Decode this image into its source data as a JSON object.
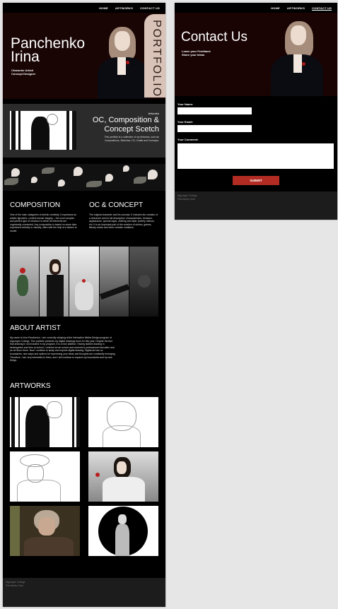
{
  "nav": {
    "home": "HOME",
    "artworks": "ARTWORKS",
    "contact": "CONTACT US"
  },
  "hero": {
    "title_line1": "Panchenko",
    "title_line2": "Irina",
    "subtitle_line1": "Character Artist/",
    "subtitle_line2": "Concept Designer",
    "band_text": "PORTFOLIO"
  },
  "oc": {
    "kicker": "Artworks",
    "title": "OC, Composition & Concept Scetch",
    "description": "This portfolio is a collection of my Artworks, such as Compositions, Sketches, OC, Drafts and Concepts."
  },
  "composition": {
    "title": "COMPOSITION",
    "text": "One of the main categories of artistic creativity. It expresses an artistic figurative, content-formal integrity – the most complex and perfect type of structure in which all elements are organically connected. Any composition is based on some idea expressed verbally or visually, often with the help of a sketch or model."
  },
  "concept": {
    "title": "OC & CONCEPT",
    "text": "The original character and his concept. It includes the creation of a character and its full description: characteristics, behavior, appearance, special signs, clothing and style, jewelry, tattoos, etc. It is an important part of the creation of stories, games, literary works and other creative creations."
  },
  "about": {
    "title": "ABOUT ARTIST",
    "text": "My name is Irina Panchenko. I am currently studying at the Interactive Media Design program of Algonquin College. This portfolio presents my digital drawings done for this year. Despite the fact that drawing is not included in my program, it is a nice addition. Having started drawing in kindergarten and then at school, I entered an art school and received a professional education and an art favor there. Now I continue to study and explore digital drawing. Digital art has no boundaries, new ways and options for expressing your ideas and thoughts are constantly emerging. Therefore, I am very interested in them, and I will continue to expand my boundaries and try new things."
  },
  "artworks": {
    "title": "ARTWORKS"
  },
  "footer": {
    "line1": "Algonquin College",
    "line2": "Panchenko Irina"
  },
  "contact": {
    "title": "Contact Us",
    "subtitle_line1": "Leave your Feedback",
    "subtitle_line2": "Share your Ideas",
    "name_label": "Your Name:",
    "email_label": "Your Email:",
    "comment_label": "Your Comment:",
    "submit_label": "SUBMIT"
  },
  "colors": {
    "accent": "#b32c24",
    "band": "#d9c3b8",
    "page_bg": "#000000"
  }
}
